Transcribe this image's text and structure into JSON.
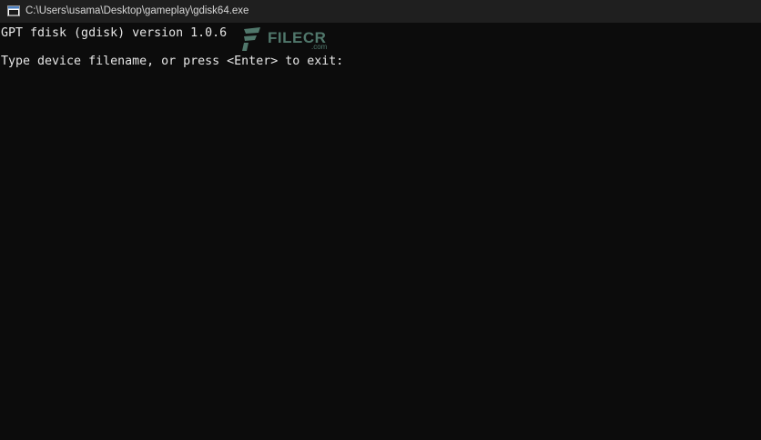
{
  "window": {
    "title": "C:\\Users\\usama\\Desktop\\gameplay\\gdisk64.exe",
    "icon": "console-app-icon"
  },
  "console": {
    "lines": [
      "GPT fdisk (gdisk) version 1.0.6",
      "Type device filename, or press <Enter> to exit:"
    ]
  },
  "watermark": {
    "brand": "FILECR",
    "suffix": ".com"
  },
  "colors": {
    "background": "#0c0c0c",
    "titlebar": "#1f1f1f",
    "text": "#e6e6e6",
    "watermark": "#5c8a7c"
  }
}
